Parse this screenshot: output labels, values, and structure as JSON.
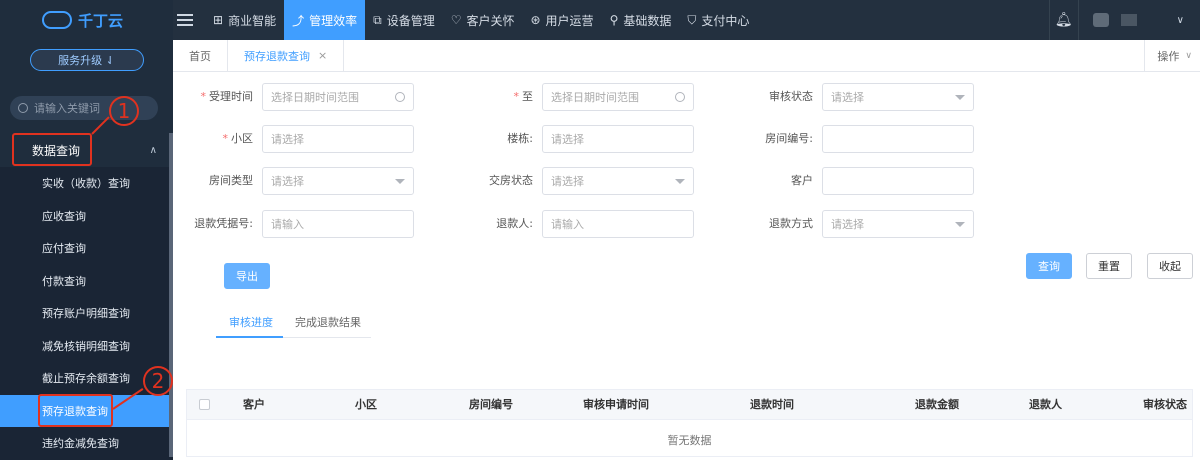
{
  "sidebar": {
    "logo_text": "千丁云",
    "upgrade_label": "服务升级 ⇃",
    "search_placeholder": "请输入关键词",
    "group_label": "数据查询",
    "items": [
      {
        "label": "实收（收款）查询"
      },
      {
        "label": "应收查询"
      },
      {
        "label": "应付查询"
      },
      {
        "label": "付款查询"
      },
      {
        "label": "预存账户明细查询"
      },
      {
        "label": "减免核销明细查询"
      },
      {
        "label": "截止预存余额查询"
      },
      {
        "label": "预存退款查询"
      },
      {
        "label": "违约金减免查询"
      }
    ],
    "active_index": 7
  },
  "annotations": {
    "one": "1",
    "two": "2"
  },
  "topnav": {
    "items": [
      {
        "label": "商业智能",
        "icon": "chart-box-icon"
      },
      {
        "label": "管理效率",
        "icon": "trend-icon"
      },
      {
        "label": "设备管理",
        "icon": "device-icon"
      },
      {
        "label": "客户关怀",
        "icon": "heart-icon"
      },
      {
        "label": "用户运营",
        "icon": "user-ops-icon"
      },
      {
        "label": "基础数据",
        "icon": "wrench-icon"
      },
      {
        "label": "支付中心",
        "icon": "shield-icon"
      }
    ],
    "active_index": 1
  },
  "tabs": {
    "home": "首页",
    "current": "预存退款查询",
    "close": "×",
    "ops": "操作"
  },
  "form": {
    "accept_time_label": "受理时间",
    "accept_time_placeholder": "选择日期时间范围",
    "to_label": "至",
    "to_placeholder": "选择日期时间范围",
    "audit_status_label": "审核状态",
    "audit_status_placeholder": "请选择",
    "community_label": "小区",
    "community_placeholder": "请选择",
    "building_label": "楼栋:",
    "building_placeholder": "请选择",
    "room_no_label": "房间编号:",
    "room_type_label": "房间类型",
    "room_type_placeholder": "请选择",
    "delivery_status_label": "交房状态",
    "delivery_status_placeholder": "请选择",
    "customer_label": "客户",
    "voucher_label": "退款凭据号:",
    "voucher_placeholder": "请输入",
    "refunder_label": "退款人:",
    "refunder_placeholder": "请输入",
    "refund_method_label": "退款方式",
    "refund_method_placeholder": "请选择"
  },
  "buttons": {
    "export": "导出",
    "query": "查询",
    "reset": "重置",
    "collapse": "收起"
  },
  "subtabs": {
    "progress": "审核进度",
    "result": "完成退款结果"
  },
  "table": {
    "columns": [
      "客户",
      "小区",
      "房间编号",
      "审核申请时间",
      "退款时间",
      "退款金额",
      "退款人",
      "审核状态"
    ],
    "empty_text": "暂无数据"
  }
}
